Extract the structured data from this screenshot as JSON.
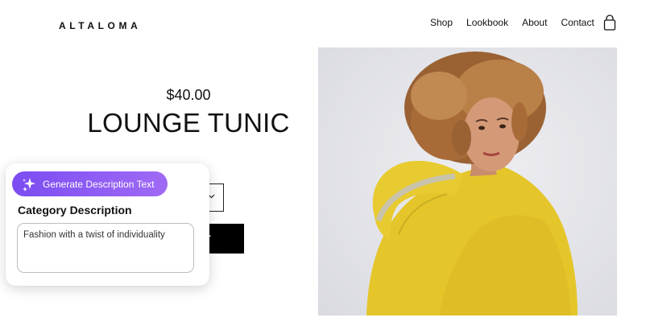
{
  "brand": "ALTALOMA",
  "nav": {
    "items": [
      "Shop",
      "Lookbook",
      "About",
      "Contact"
    ],
    "cart_icon": "shopping-bag-icon"
  },
  "product": {
    "price": "$40.00",
    "title": "LOUNGE TUNIC",
    "add_button_visible_text": "T",
    "size_select_icon": "chevron-down-icon",
    "image_description": "curly-haired model in yellow hoodie"
  },
  "ai_panel": {
    "generate_button": "Generate Description Text",
    "generate_icon": "sparkle-icon",
    "label": "Category Description",
    "description_value": "Fashion with a twist of individuality"
  },
  "colors": {
    "accent_start": "#7b4cf2",
    "accent_end": "#a06af5",
    "hoodie": "#e4c62a",
    "photo_bg": "#e2e3e8"
  }
}
